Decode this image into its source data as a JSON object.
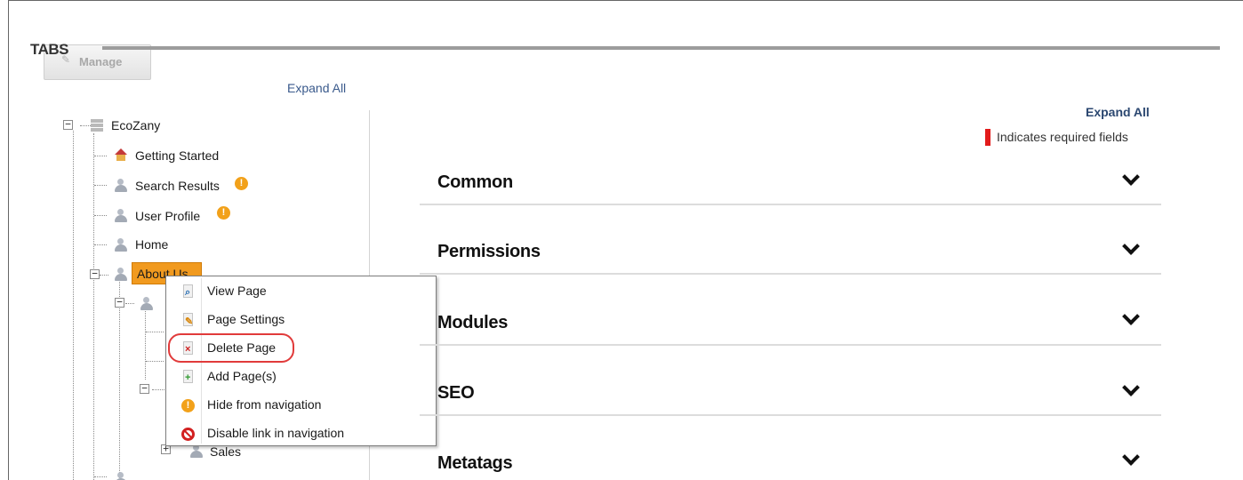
{
  "header": {
    "title": "TABS",
    "manage_label": "Manage"
  },
  "tree": {
    "expand_all": "Expand All",
    "root": "EcoZany",
    "items": [
      {
        "label": "Getting Started",
        "icon": "home-icon"
      },
      {
        "label": "Search Results",
        "icon": "user-page-icon",
        "warning": true
      },
      {
        "label": "User Profile",
        "icon": "user-page-icon",
        "warning": true
      },
      {
        "label": "Home",
        "icon": "user-page-icon"
      },
      {
        "label": "About Us",
        "icon": "user-page-icon",
        "selected": true
      },
      {
        "label": "Sales",
        "icon": "user-page-icon"
      }
    ]
  },
  "context_menu": {
    "items": [
      {
        "label": "View Page",
        "icon": "view-page-icon"
      },
      {
        "label": "Page Settings",
        "icon": "page-settings-icon"
      },
      {
        "label": "Delete Page",
        "icon": "delete-page-icon",
        "highlighted": true
      },
      {
        "label": "Add Page(s)",
        "icon": "add-page-icon"
      },
      {
        "label": "Hide from navigation",
        "icon": "warning-icon"
      },
      {
        "label": "Disable link in navigation",
        "icon": "disable-icon"
      }
    ]
  },
  "panel": {
    "expand_all": "Expand All",
    "required_note": "Indicates required fields",
    "sections": [
      "Common",
      "Permissions",
      "Modules",
      "SEO",
      "Metatags"
    ]
  },
  "colors": {
    "selected_node": "#f19a1f",
    "highlight_ring": "#e13b3b",
    "required_marker": "#e21b1b",
    "link": "#2b4770",
    "warning": "#f2a11a"
  }
}
